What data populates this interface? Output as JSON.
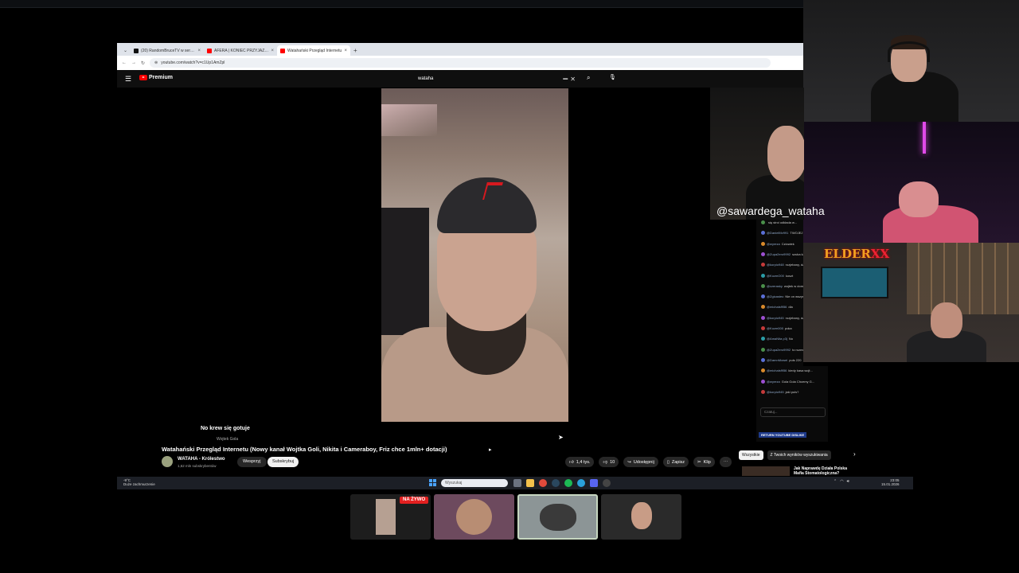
{
  "browser": {
    "tabs": [
      {
        "label": "(20) RandomBruceTV w serwisie X",
        "color": "#111111"
      },
      {
        "label": "AFERA | KONIEC PRZYJAŹNI Z ...",
        "color": "#ff0000"
      },
      {
        "label": "Watahański Przegląd Internetu",
        "color": "#ff0000"
      }
    ],
    "new_tab": "+",
    "url": "youtube.com/watch?v=c1Up1AmZpl"
  },
  "youtube": {
    "logo_text": "Premium",
    "search_query": "wataha",
    "clear_icon": "✕",
    "search_icon": "⌕",
    "mic_icon": "🎙"
  },
  "video": {
    "caption": "No krew się gotuje",
    "caption_sub": "Wojtek Gola",
    "title": "Watahański Przegląd Internetu (Nowy kanał Wojtka Goli, Nikita i Cameraboy, Friz chce 1mln+ dotacji)",
    "channel_name": "WATAHA - Królestwo",
    "channel_subs": "1,62 mln subskrybentów",
    "support_label": "Wesprzyj",
    "subscribe_label": "Subskrybuj",
    "like_count": "1,4 tys.",
    "dislike_count": "10",
    "share_label": "Udostępnij",
    "save_label": "Zapisz",
    "clip_label": "Klip",
    "more_label": "⋯"
  },
  "recommendations": {
    "chips": [
      "Wszystkie",
      "Z Twoich wyników wyszukiwania"
    ],
    "next_icon": "›",
    "first_title": "Jak Naprawdę Działa Polska Mafia Stomatologiczna?"
  },
  "chat": {
    "messages": [
      {
        "user": "",
        "text": "się stroi odkłada w..."
      },
      {
        "user": "@DanielMv991",
        "text": "TWOJEJ STRONY"
      },
      {
        "user": "@wyreza",
        "text": "Cziowiek"
      },
      {
        "user": "@Zupa2ero9992",
        "text": "szuka kasity na..."
      },
      {
        "user": "@korpio948",
        "text": "rozjebany, dzwoni milionera który..."
      },
      {
        "user": "@KozmO00",
        "text": "koszt"
      },
      {
        "user": "@czerasky",
        "text": "wojtek w domu"
      },
      {
        "user": "@Zgicasteo",
        "text": "Nie on wszystko kamie"
      },
      {
        "user": "@michalsf956",
        "text": "dla"
      },
      {
        "user": "@korpio945",
        "text": "rozjebany, dzwoni milionera który..."
      },
      {
        "user": "@Kozm000",
        "text": "poka"
      },
      {
        "user": "@AmaNita p3j",
        "text": "No"
      },
      {
        "user": "@Zupa2ero9992",
        "text": "to rozmowa z ból..."
      },
      {
        "user": "@DamnMowel",
        "text": "puls 220"
      },
      {
        "user": "@michalsf956",
        "text": "kiedy kasa wojt..."
      },
      {
        "user": "@wyreza",
        "text": "Gola Gola Chcemy G..."
      },
      {
        "user": "@korpio945",
        "text": "jaki puls?"
      }
    ],
    "input_placeholder": "Czatuj...",
    "return_label": "RETURN YOUTUBE DISLIKE"
  },
  "overlay": {
    "cam_handle": "@sawardega_wataha",
    "elder_prefix": "ELDER",
    "elder_suffix": "XX"
  },
  "taskbar": {
    "weather": "-9°C",
    "weather_desc": "Duże zachmurzenie",
    "search_placeholder": "Wyszukaj",
    "time": "23:05",
    "date": "15.01.2026"
  },
  "participants": {
    "live_label": "NA ŻYWO"
  }
}
